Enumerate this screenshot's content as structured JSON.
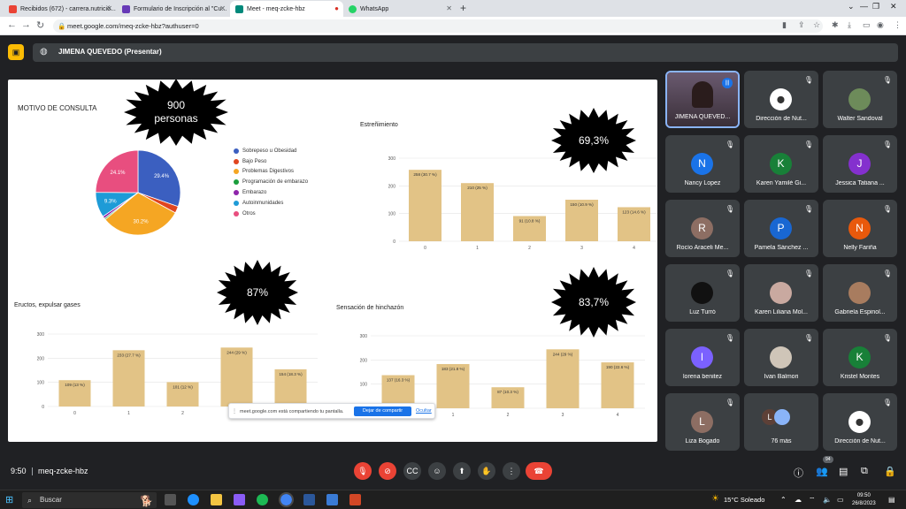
{
  "browser": {
    "tabs": [
      {
        "title": "Recibidos (672) - carrera.nutrició...",
        "icon_color": "#ea4335",
        "active": false
      },
      {
        "title": "Formulario de Inscripción al \"Cu...",
        "icon_color": "#673ab7",
        "active": false
      },
      {
        "title": "Meet - meq-zcke-hbz",
        "icon_color": "#00897b",
        "active": true
      },
      {
        "title": "WhatsApp",
        "icon_color": "#25d366",
        "active": false
      }
    ],
    "url": "meet.google.com/meq-zcke-hbz?authuser=0"
  },
  "meet": {
    "presenter_label": "JIMENA QUEVEDO (Presentar)",
    "meeting_time": "9:50",
    "meeting_code": "meq-zcke-hbz",
    "participants_badge": "94"
  },
  "slide": {
    "main_title": "MOTIVO DE CONSULTA",
    "bursts": [
      {
        "text": "900 personas"
      },
      {
        "text": "69,3%"
      },
      {
        "text": "87%"
      },
      {
        "text": "83,7%"
      }
    ],
    "share_notice": {
      "text": "meet.google.com está compartiendo tu pantalla.",
      "stop_label": "Dejar de compartir",
      "hide_label": "Ocultar"
    }
  },
  "chart_data": [
    {
      "type": "pie",
      "title": "",
      "legend_position": "right",
      "categories": [
        "Sobrepeso u Obesidad",
        "Bajo Peso",
        "Problemas Digestivos",
        "Programación de embarazo",
        "Embarazo",
        "Autoinmunidades",
        "Otros"
      ],
      "values": [
        29.4,
        2.5,
        30.2,
        0.5,
        0.9,
        9.3,
        24.1
      ],
      "labels": [
        "29.4%",
        "",
        "30.2%",
        "",
        "",
        "9.3%",
        "24.1%"
      ],
      "colors": [
        "#3b5fc0",
        "#e0451f",
        "#f5a623",
        "#1a9e3c",
        "#8e24aa",
        "#1e9bd7",
        "#e84e7f"
      ]
    },
    {
      "type": "bar",
      "title": "Estreñimiento",
      "categories": [
        "0",
        "1",
        "2",
        "3",
        "4"
      ],
      "values": [
        258,
        210,
        91,
        150,
        123
      ],
      "labels": [
        "258 (30.7 %)",
        "210 (25 %)",
        "91 (10.8 %)",
        "150 (10.9 %)",
        "123 (14.6 %)"
      ],
      "yticks": [
        "0",
        "100",
        "200",
        "300"
      ],
      "ylim": [
        0,
        300
      ],
      "grid": true,
      "color": "#e2c386"
    },
    {
      "type": "bar",
      "title": "Eructos, expulsar gases",
      "categories": [
        "0",
        "1",
        "2",
        "3",
        "4"
      ],
      "values": [
        109,
        233,
        101,
        244,
        154
      ],
      "labels": [
        "109 (13 %)",
        "233 (27.7 %)",
        "101 (12 %)",
        "244 (29 %)",
        "154 (18.3 %)"
      ],
      "yticks": [
        "0",
        "100",
        "200",
        "300"
      ],
      "ylim": [
        0,
        300
      ],
      "grid": true,
      "color": "#e2c386"
    },
    {
      "type": "bar",
      "title": "Sensación de hinchazón",
      "categories": [
        "0",
        "1",
        "2",
        "3",
        "4"
      ],
      "values": [
        137,
        183,
        87,
        244,
        190
      ],
      "labels": [
        "137 (16.3 %)",
        "183 (21.8 %)",
        "87 (10.3 %)",
        "244 (29 %)",
        "190 (22.6 %)"
      ],
      "yticks": [
        "0",
        "100",
        "200",
        "300"
      ],
      "ylim": [
        0,
        300
      ],
      "grid": true,
      "color": "#e2c386"
    }
  ],
  "participants": [
    {
      "name": "JIMENA QUEVED...",
      "type": "self"
    },
    {
      "name": "Dirección de Nut...",
      "type": "logo"
    },
    {
      "name": "Walter Sandoval",
      "type": "photo",
      "color": "#6d8b5a"
    },
    {
      "name": "Nancy Lopez",
      "initial": "N",
      "color": "#1a73e8"
    },
    {
      "name": "Karen Yamilé Gi...",
      "initial": "K",
      "color": "#188038"
    },
    {
      "name": "Jessica Tatiana ...",
      "initial": "J",
      "color": "#8430ce"
    },
    {
      "name": "Rocío Araceli Me...",
      "initial": "R",
      "color": "#8d6e63"
    },
    {
      "name": "Pamela Sánchez ...",
      "initial": "P",
      "color": "#1967d2"
    },
    {
      "name": "Nelly Fariña",
      "initial": "N",
      "color": "#e8590c"
    },
    {
      "name": "Luz Turró",
      "type": "photo",
      "color": "#111111"
    },
    {
      "name": "Karen Liliana Mol...",
      "type": "photo",
      "color": "#c9a9a0"
    },
    {
      "name": "Gabriela Espinol...",
      "type": "photo",
      "color": "#a87c5f"
    },
    {
      "name": "lorena benitez",
      "initial": "l",
      "color": "#7b61ff"
    },
    {
      "name": "Ivan Balmori",
      "type": "photo",
      "color": "#cfc5b8"
    },
    {
      "name": "Kristel Montes",
      "initial": "K",
      "color": "#188038"
    },
    {
      "name": "Liza Bogado",
      "initial": "L",
      "color": "#8d6e63"
    },
    {
      "name": "76 más",
      "type": "more",
      "initial": "L",
      "color": "#5d4037"
    },
    {
      "name": "Dirección de Nut...",
      "type": "logo"
    }
  ],
  "taskbar": {
    "search_placeholder": "Buscar",
    "weather": "15°C  Soleado",
    "time": "09:50",
    "date": "26/8/2023"
  }
}
